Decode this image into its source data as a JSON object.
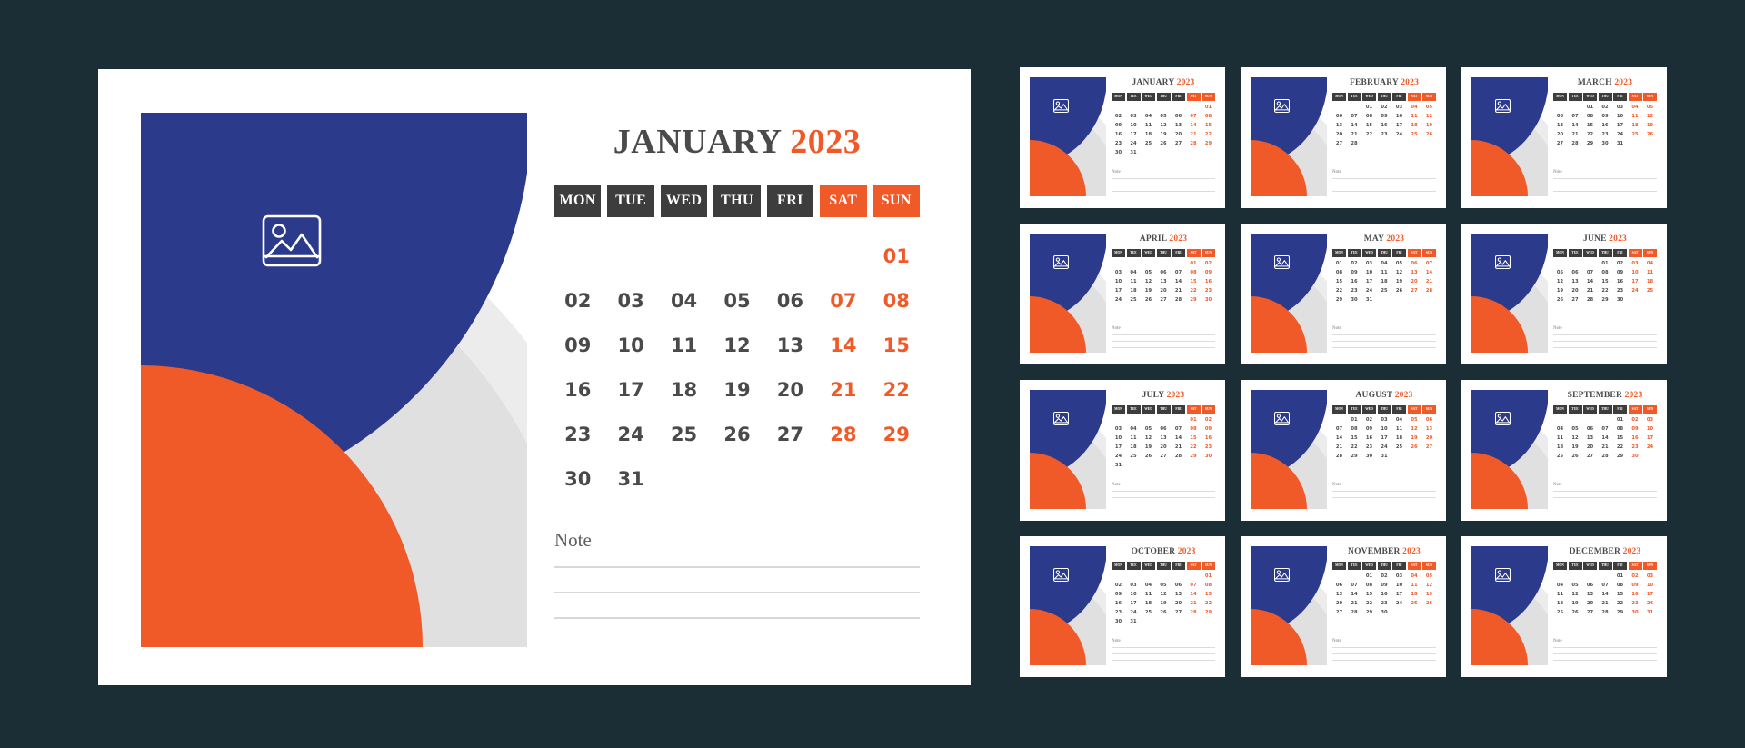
{
  "theme": {
    "background": "#1c2e35",
    "card": "#ffffff",
    "blue": "#2c3a8c",
    "orange": "#f05a28",
    "dark_gray": "#3d3d3d",
    "text_gray": "#4a4a4a",
    "gray_arc_outer": "#ececec",
    "gray_arc_inner": "#e0e0e0",
    "note_line": "#d8d8d8"
  },
  "year": "2023",
  "weekdays": [
    "MON",
    "TUE",
    "WED",
    "THU",
    "FRI",
    "SAT",
    "SUN"
  ],
  "weekend_indices": [
    5,
    6
  ],
  "note_label": "Note",
  "note_line_count": 3,
  "image_placeholder_icon": "image-placeholder-icon",
  "featured": {
    "month": "JANUARY",
    "year": "2023",
    "days": [
      "",
      "",
      "",
      "",
      "",
      "",
      "01",
      "02",
      "03",
      "04",
      "05",
      "06",
      "07",
      "08",
      "09",
      "10",
      "11",
      "12",
      "13",
      "14",
      "15",
      "16",
      "17",
      "18",
      "19",
      "20",
      "21",
      "22",
      "23",
      "24",
      "25",
      "26",
      "27",
      "28",
      "29",
      "30",
      "31",
      "",
      "",
      "",
      "",
      ""
    ]
  },
  "months": [
    {
      "month": "JANUARY",
      "year": "2023",
      "days": [
        "",
        "",
        "",
        "",
        "",
        "",
        "01",
        "02",
        "03",
        "04",
        "05",
        "06",
        "07",
        "08",
        "09",
        "10",
        "11",
        "12",
        "13",
        "14",
        "15",
        "16",
        "17",
        "18",
        "19",
        "20",
        "21",
        "22",
        "23",
        "24",
        "25",
        "26",
        "27",
        "28",
        "29",
        "30",
        "31",
        "",
        "",
        "",
        "",
        ""
      ]
    },
    {
      "month": "FEBRUARY",
      "year": "2023",
      "days": [
        "",
        "",
        "01",
        "02",
        "03",
        "04",
        "05",
        "06",
        "07",
        "08",
        "09",
        "10",
        "11",
        "12",
        "13",
        "14",
        "15",
        "16",
        "17",
        "18",
        "19",
        "20",
        "21",
        "22",
        "23",
        "24",
        "25",
        "26",
        "27",
        "28",
        "",
        "",
        "",
        "",
        "",
        "",
        "",
        "",
        "",
        "",
        "",
        ""
      ]
    },
    {
      "month": "MARCH",
      "year": "2023",
      "days": [
        "",
        "",
        "01",
        "02",
        "03",
        "04",
        "05",
        "06",
        "07",
        "08",
        "09",
        "10",
        "11",
        "12",
        "13",
        "14",
        "15",
        "16",
        "17",
        "18",
        "19",
        "20",
        "21",
        "22",
        "23",
        "24",
        "25",
        "26",
        "27",
        "28",
        "29",
        "30",
        "31",
        "",
        "",
        "",
        "",
        "",
        "",
        "",
        "",
        ""
      ]
    },
    {
      "month": "APRIL",
      "year": "2023",
      "days": [
        "",
        "",
        "",
        "",
        "",
        "01",
        "02",
        "03",
        "04",
        "05",
        "06",
        "07",
        "08",
        "09",
        "10",
        "11",
        "12",
        "13",
        "14",
        "15",
        "16",
        "17",
        "18",
        "19",
        "20",
        "21",
        "22",
        "23",
        "24",
        "25",
        "26",
        "27",
        "28",
        "29",
        "30",
        "",
        "",
        "",
        "",
        "",
        "",
        ""
      ]
    },
    {
      "month": "MAY",
      "year": "2023",
      "days": [
        "01",
        "02",
        "03",
        "04",
        "05",
        "06",
        "07",
        "08",
        "09",
        "10",
        "11",
        "12",
        "13",
        "14",
        "15",
        "16",
        "17",
        "18",
        "19",
        "20",
        "21",
        "22",
        "23",
        "24",
        "25",
        "26",
        "27",
        "28",
        "29",
        "30",
        "31",
        "",
        "",
        "",
        "",
        "",
        "",
        "",
        "",
        "",
        "",
        ""
      ]
    },
    {
      "month": "JUNE",
      "year": "2023",
      "days": [
        "",
        "",
        "",
        "01",
        "02",
        "03",
        "04",
        "05",
        "06",
        "07",
        "08",
        "09",
        "10",
        "11",
        "12",
        "13",
        "14",
        "15",
        "16",
        "17",
        "18",
        "19",
        "20",
        "21",
        "22",
        "23",
        "24",
        "25",
        "26",
        "27",
        "28",
        "29",
        "30",
        "",
        "",
        "",
        "",
        "",
        "",
        "",
        "",
        ""
      ]
    },
    {
      "month": "JULY",
      "year": "2023",
      "days": [
        "",
        "",
        "",
        "",
        "",
        "01",
        "02",
        "03",
        "04",
        "05",
        "06",
        "07",
        "08",
        "09",
        "10",
        "11",
        "12",
        "13",
        "14",
        "15",
        "16",
        "17",
        "18",
        "19",
        "20",
        "21",
        "22",
        "23",
        "24",
        "25",
        "26",
        "27",
        "28",
        "29",
        "30",
        "31",
        "",
        "",
        "",
        "",
        "",
        ""
      ]
    },
    {
      "month": "AUGUST",
      "year": "2023",
      "days": [
        "",
        "01",
        "02",
        "03",
        "04",
        "05",
        "06",
        "07",
        "08",
        "09",
        "10",
        "11",
        "12",
        "13",
        "14",
        "15",
        "16",
        "17",
        "18",
        "19",
        "20",
        "21",
        "22",
        "23",
        "24",
        "25",
        "26",
        "27",
        "28",
        "29",
        "30",
        "31",
        "",
        "",
        "",
        "",
        "",
        "",
        "",
        "",
        "",
        ""
      ]
    },
    {
      "month": "SEPTEMBER",
      "year": "2023",
      "days": [
        "",
        "",
        "",
        "",
        "01",
        "02",
        "03",
        "04",
        "05",
        "06",
        "07",
        "08",
        "09",
        "10",
        "11",
        "12",
        "13",
        "14",
        "15",
        "16",
        "17",
        "18",
        "19",
        "20",
        "21",
        "22",
        "23",
        "24",
        "25",
        "26",
        "27",
        "28",
        "29",
        "30",
        "",
        "",
        "",
        "",
        "",
        "",
        "",
        ""
      ]
    },
    {
      "month": "OCTOBER",
      "year": "2023",
      "days": [
        "",
        "",
        "",
        "",
        "",
        "",
        "01",
        "02",
        "03",
        "04",
        "05",
        "06",
        "07",
        "08",
        "09",
        "10",
        "11",
        "12",
        "13",
        "14",
        "15",
        "16",
        "17",
        "18",
        "19",
        "20",
        "21",
        "22",
        "23",
        "24",
        "25",
        "26",
        "27",
        "28",
        "29",
        "30",
        "31",
        "",
        "",
        "",
        "",
        ""
      ]
    },
    {
      "month": "NOVEMBER",
      "year": "2023",
      "days": [
        "",
        "",
        "01",
        "02",
        "03",
        "04",
        "05",
        "06",
        "07",
        "08",
        "09",
        "10",
        "11",
        "12",
        "13",
        "14",
        "15",
        "16",
        "17",
        "18",
        "19",
        "20",
        "21",
        "22",
        "23",
        "24",
        "25",
        "26",
        "27",
        "28",
        "29",
        "30",
        "",
        "",
        "",
        "",
        "",
        "",
        "",
        "",
        "",
        ""
      ]
    },
    {
      "month": "DECEMBER",
      "year": "2023",
      "days": [
        "",
        "",
        "",
        "",
        "01",
        "02",
        "03",
        "04",
        "05",
        "06",
        "07",
        "08",
        "09",
        "10",
        "11",
        "12",
        "13",
        "14",
        "15",
        "16",
        "17",
        "18",
        "19",
        "20",
        "21",
        "22",
        "23",
        "24",
        "25",
        "26",
        "27",
        "28",
        "29",
        "30",
        "31",
        "",
        "",
        "",
        "",
        "",
        "",
        ""
      ]
    }
  ]
}
